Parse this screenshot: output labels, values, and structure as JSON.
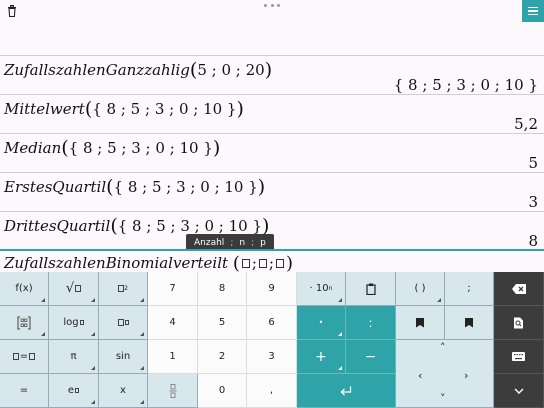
{
  "toolbar": {
    "delete_icon": "trash-icon",
    "more_icon": "more-dots-icon",
    "menu_icon": "hamburger-menu-icon"
  },
  "history": [
    {
      "function": "ZufallszahlenGanzzahlig",
      "args": "5 ; 0 ; 20",
      "result": "{ 8 ; 5 ; 3 ; 0 ; 10 }"
    },
    {
      "function": "Mittelwert",
      "args": "{ 8 ; 5 ; 3 ; 0 ; 10 }",
      "result": "5,2"
    },
    {
      "function": "Median",
      "args": "{ 8 ; 5 ; 3 ; 0 ; 10 }",
      "result": "5"
    },
    {
      "function": "ErstesQuartil",
      "args": "{ 8 ; 5 ; 3 ; 0 ; 10 }",
      "result": "3"
    },
    {
      "function": "DrittesQuartil",
      "args": "{ 8 ; 5 ; 3 ; 0 ; 10 }",
      "result": "8"
    }
  ],
  "input": {
    "function": "ZufallszahlenBinomialverteilt",
    "separator": ";"
  },
  "tooltip": {
    "label": "Anzahl",
    "params": [
      "n",
      "p"
    ],
    "separator": ";"
  },
  "keyboard": {
    "row1": [
      "f(x)",
      "√▫",
      "▫²",
      "7",
      "8",
      "9",
      "· 10ⁿ",
      "clipboard-icon",
      "( )",
      ";",
      "backspace-icon"
    ],
    "row2": [
      "matrix-icon",
      "log▫",
      "▫▫",
      "4",
      "5",
      "6",
      "•",
      ":",
      "bookmark-icon",
      "bookmark-icon",
      "search-document-icon"
    ],
    "row3": [
      "▫=▫",
      "π",
      "sin",
      "1",
      "2",
      "3",
      "+",
      "−",
      "arrow-keys",
      "keyboard-icon"
    ],
    "row4": [
      "=",
      "e▫",
      "x",
      "fraction-icon",
      "0",
      ",",
      "enter-icon",
      "chevron-down-icon"
    ],
    "labels": {
      "fx": "f(x)",
      "sqrt": "√",
      "sq": "2",
      "seven": "7",
      "eight": "8",
      "nine": "9",
      "tenpow": "· 10",
      "tenpow_sup": "n",
      "paren": "( )",
      "semicolon": ";",
      "log": "log",
      "four": "4",
      "five": "5",
      "six": "6",
      "dot": "•",
      "colon": ":",
      "eqbox": "=",
      "pi": "π",
      "sin": "sin",
      "one": "1",
      "two": "2",
      "three": "3",
      "plus": "+",
      "minus": "−",
      "equals": "=",
      "e": "e",
      "x": "x",
      "zero": "0",
      "comma": ","
    }
  }
}
